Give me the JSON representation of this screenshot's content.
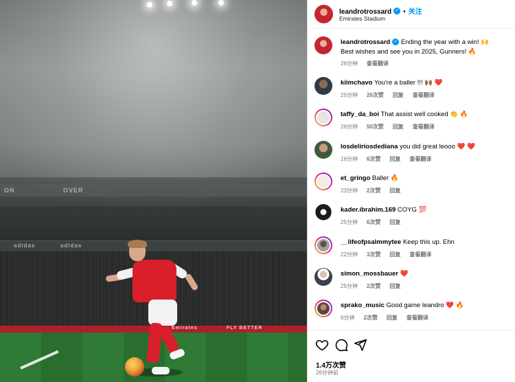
{
  "post": {
    "author": "leandrotrossard",
    "follow_label": "关注",
    "location": "Emirates Stadium",
    "caption_line1": "Ending the year with a win! 🙌",
    "caption_line2": "Best wishes and see you in 2025, Gunners! 🔥",
    "caption_time": "26分钟",
    "translate_label": "查看翻译"
  },
  "photo": {
    "board_texts": [
      "ON",
      "OVER",
      "adidas",
      "adidas",
      "Emirates",
      "FLY BETTER"
    ]
  },
  "comments": [
    {
      "user": "kiimchavo",
      "text": "You're a baller !!! 🙌🏾 ❤️",
      "time": "25分钟",
      "likes": "26次赞",
      "reply": "回复",
      "translate": "查看翻译"
    },
    {
      "user": "taffy_da_boi",
      "text": "That assist well cooked 👏 🔥",
      "time": "26分钟",
      "likes": "50次赞",
      "reply": "回复",
      "translate": "查看翻译"
    },
    {
      "user": "losdeliriosdediana",
      "text": "you did great leooo ❤️ ❤️",
      "time": "16分钟",
      "likes": "6次赞",
      "reply": "回复",
      "translate": "查看翻译"
    },
    {
      "user": "et_gringo",
      "text": "Baller 🔥",
      "time": "23分钟",
      "likes": "2次赞",
      "reply": "回复",
      "translate": ""
    },
    {
      "user": "kader.ibrahim.169",
      "text": "COYG 💯",
      "time": "25分钟",
      "likes": "6次赞",
      "reply": "回复",
      "translate": ""
    },
    {
      "user": "__lifeofpsalmmytee",
      "text": "Keep this up. Ehn",
      "time": "22分钟",
      "likes": "3次赞",
      "reply": "回复",
      "translate": "查看翻译"
    },
    {
      "user": "simon_mossbauer",
      "text": "❤️",
      "time": "25分钟",
      "likes": "2次赞",
      "reply": "回复",
      "translate": ""
    },
    {
      "user": "sprako_music",
      "text": "Good game leandro ❤️ 🔥",
      "time": "6分钟",
      "likes": "2次赞",
      "reply": "回复",
      "translate": "查看翻译"
    }
  ],
  "footer": {
    "likes": "1.4万次赞",
    "time_ago": "26分钟前"
  },
  "icons": {
    "like": "heart-icon",
    "comment": "comment-icon",
    "share": "share-icon",
    "verified": "verified-badge-icon"
  },
  "colors": {
    "accent": "#0095f6",
    "like_red": "#ed4956",
    "meta_grey": "#737373",
    "arsenal_red": "#d81f2a"
  }
}
